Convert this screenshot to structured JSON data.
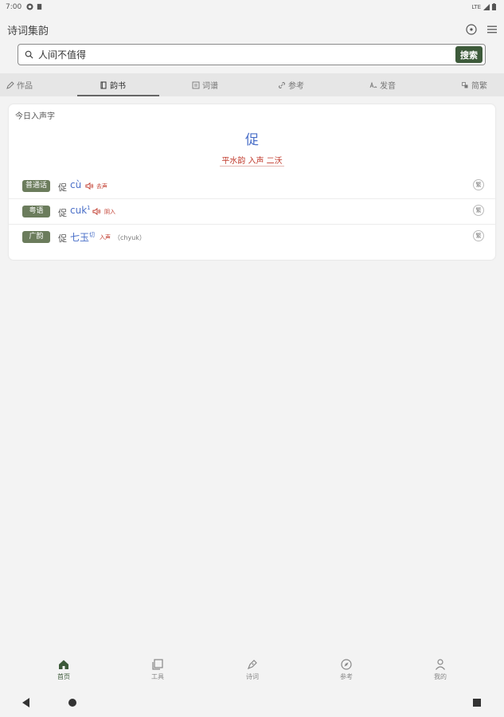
{
  "status": {
    "time": "7:00",
    "network": "LTE"
  },
  "app": {
    "title": "诗词集韵"
  },
  "search": {
    "value": "人间不值得",
    "button_label": "搜索"
  },
  "tabs": [
    {
      "label": "作品",
      "icon": "pencil-icon"
    },
    {
      "label": "韵书",
      "icon": "book-icon",
      "active": true
    },
    {
      "label": "词谱",
      "icon": "ci-icon"
    },
    {
      "label": "参考",
      "icon": "link-icon"
    },
    {
      "label": "发音",
      "icon": "pronunciation-icon"
    },
    {
      "label": "简繁",
      "icon": "convert-icon"
    }
  ],
  "card": {
    "title": "今日入声字",
    "character": "促",
    "rhyme": "平水韵 入声 二沃",
    "readings": [
      {
        "badge": "普通话",
        "char": "促",
        "romanization": "cù",
        "tone": "去声",
        "extra": "",
        "circle": "繁"
      },
      {
        "badge": "粤语",
        "char": "促",
        "romanization": "cuk",
        "sup": "1",
        "tone": "阴入",
        "extra": "",
        "circle": "繁"
      },
      {
        "badge": "广韵",
        "char": "促",
        "romanization": "七玉",
        "sup": "切",
        "tone": "入声",
        "extra": "（chyuk）",
        "circle": "繁"
      }
    ]
  },
  "bottom_nav": [
    {
      "label": "首页",
      "icon": "home-icon",
      "active": true
    },
    {
      "label": "工具",
      "icon": "tools-icon"
    },
    {
      "label": "诗词",
      "icon": "poetry-icon"
    },
    {
      "label": "参考",
      "icon": "compass-icon"
    },
    {
      "label": "我的",
      "icon": "person-icon"
    }
  ],
  "colors": {
    "accent": "#3d5a3a",
    "badge": "#6b7c5c",
    "romanization": "#4a6fc8",
    "tone": "#c0392b"
  }
}
